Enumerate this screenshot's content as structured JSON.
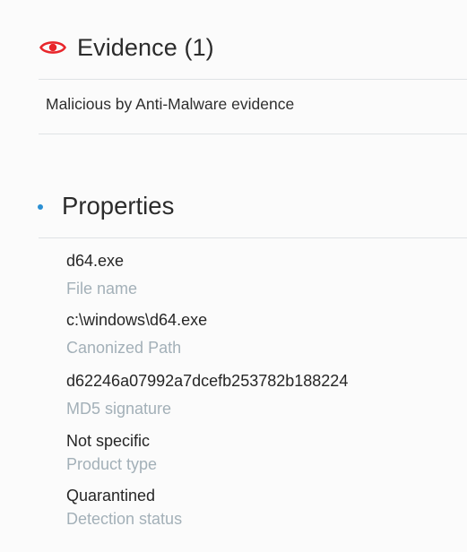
{
  "evidence": {
    "title": "Evidence (1)",
    "icon": "eye-icon",
    "accent_color": "#e8262b",
    "items": [
      {
        "text": "Malicious by Anti-Malware evidence"
      }
    ]
  },
  "properties": {
    "title": "Properties",
    "bullet_color": "#2a8fd3",
    "items": [
      {
        "value": "d64.exe",
        "label": "File name"
      },
      {
        "value": "c:\\windows\\d64.exe",
        "label": "Canonized Path"
      },
      {
        "value": "d62246a07992a7dcefb253782b188224",
        "label": "MD5 signature"
      },
      {
        "value": "Not specific",
        "label": "Product type"
      },
      {
        "value": "Quarantined",
        "label": "Detection status"
      }
    ]
  }
}
